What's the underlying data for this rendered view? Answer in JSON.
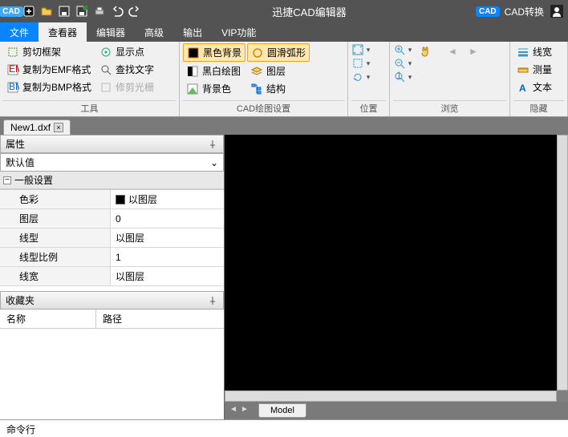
{
  "title": "迅捷CAD编辑器",
  "titlebar_right": {
    "badge": "CAD",
    "label": "CAD转换"
  },
  "menus": {
    "file": "文件",
    "viewer": "查看器",
    "editor": "编辑器",
    "advanced": "高级",
    "output": "输出",
    "vip": "VIP功能"
  },
  "ribbon": {
    "tools": {
      "title": "工具",
      "crop": "剪切框架",
      "emf": "复制为EMF格式",
      "bmp": "复制为BMP格式",
      "showpt": "显示点",
      "findtxt": "查找文字",
      "trimhatch": "修剪光栅"
    },
    "draw": {
      "title": "CAD绘图设置",
      "blackbg": "黑色背景",
      "smooth": "圆滑弧形",
      "bw": "黑白绘图",
      "bgcolor": "背景色",
      "layer": "图层",
      "struct": "结构"
    },
    "pos": {
      "title": "位置"
    },
    "browse": {
      "title": "浏览"
    },
    "hide": {
      "title": "隐藏",
      "lw": "线宽",
      "measure": "测量",
      "text": "文本"
    }
  },
  "doc_tab": "New1.dxf",
  "props": {
    "panel": "属性",
    "default": "默认值",
    "section": "一般设置",
    "rows": [
      {
        "k": "色彩",
        "v": "以图层",
        "swatch": true
      },
      {
        "k": "图层",
        "v": "0"
      },
      {
        "k": "线型",
        "v": "以图层"
      },
      {
        "k": "线型比例",
        "v": "1"
      },
      {
        "k": "线宽",
        "v": "以图层"
      }
    ]
  },
  "fav": {
    "panel": "收藏夹",
    "name": "名称",
    "path": "路径"
  },
  "model_tab": "Model",
  "cmd": "命令行"
}
